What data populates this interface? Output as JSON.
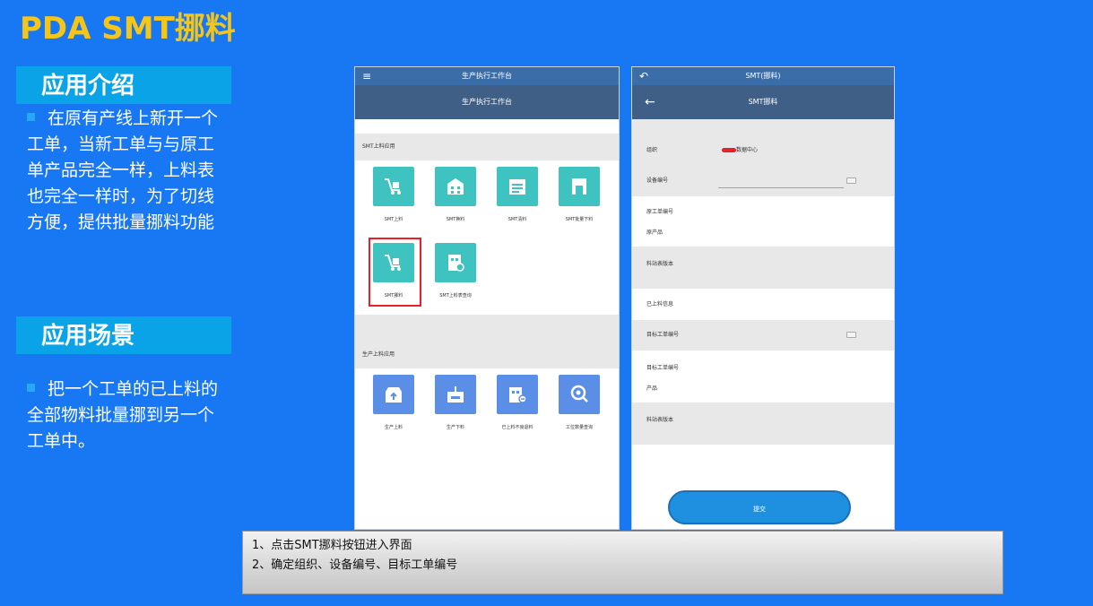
{
  "slide": {
    "title": "PDA SMT挪料",
    "intro_heading": "应用介绍",
    "intro_text": "在原有产线上新开一个工单，当新工单与与原工单产品完全一样，上料表也完全一样时，为了切线方便，提供批量挪料功能",
    "scene_heading": "应用场景",
    "scene_text": "把一个工单的已上料的全部物料批量挪到另一个工单中。"
  },
  "phone1": {
    "status_title": "生产执行工作台",
    "appbar_title": "生产执行工作台",
    "section1": "SMT上料应用",
    "section2": "生产上料应用",
    "tiles": [
      {
        "label": "SMT上料",
        "icon": "cart-icon"
      },
      {
        "label": "SMT换料",
        "icon": "building-icon"
      },
      {
        "label": "SMT清料",
        "icon": "calendar-icon"
      },
      {
        "label": "SMT批量下料",
        "icon": "door-icon"
      },
      {
        "label": "SMT挪料",
        "icon": "cart-icon"
      },
      {
        "label": "SMT上料表查询",
        "icon": "building-search-icon"
      },
      {
        "label": "生产上料",
        "icon": "box-up-icon"
      },
      {
        "label": "生产下料",
        "icon": "box-down-icon"
      },
      {
        "label": "已上料不良退料",
        "icon": "building-minus-icon"
      },
      {
        "label": "工位数量查询",
        "icon": "search-icon"
      }
    ]
  },
  "phone2": {
    "status_title": "SMT(挪料)",
    "appbar_title": "SMT挪料",
    "fields": {
      "org_label": "组织",
      "org_value": "数据中心",
      "device_label": "设备编号",
      "orig_wo_label": "原工单编号",
      "orig_product_label": "原产品",
      "station_version_label": "料站表版本",
      "loaded_info_label": "已上料信息",
      "target_wo_label": "目标工单编号",
      "target_wo_label2": "目标工单编号",
      "product_label": "产品",
      "station_version_label2": "料站表版本"
    },
    "submit_label": "提交"
  },
  "notes": {
    "line1": "1、点击SMT挪料按钮进入界面",
    "line2": "2、确定组织、设备编号、目标工单编号"
  },
  "colors": {
    "background": "#1877f2",
    "title": "#f5c518",
    "section_head": "#0aa3e8",
    "tile_teal": "#3ec3c0",
    "tile_blue": "#5b8ee6",
    "highlight": "#e8202a"
  }
}
